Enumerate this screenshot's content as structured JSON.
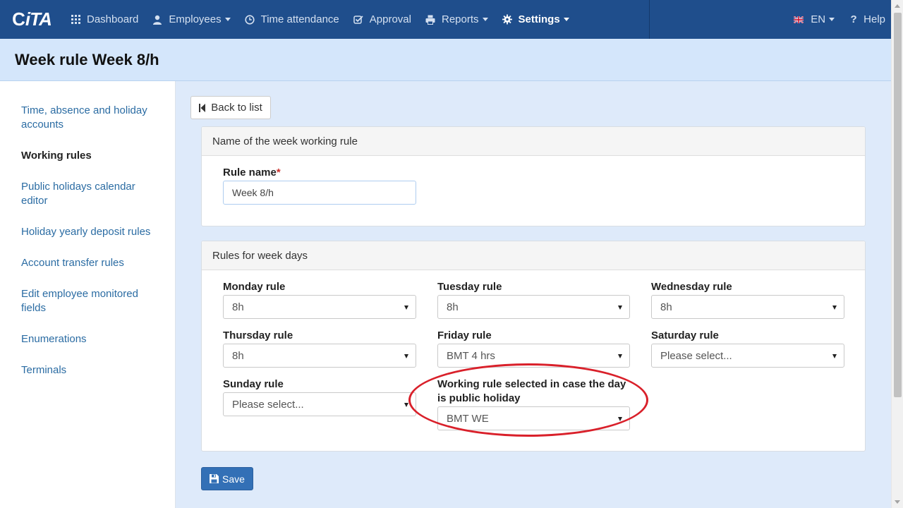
{
  "brand": {
    "name": "iTA"
  },
  "nav": {
    "items": [
      {
        "label": "Dashboard",
        "icon": "grid-icon"
      },
      {
        "label": "Employees",
        "icon": "user-icon",
        "dropdown": true
      },
      {
        "label": "Time attendance",
        "icon": "clock-icon"
      },
      {
        "label": "Approval",
        "icon": "check-square-icon"
      },
      {
        "label": "Reports",
        "icon": "printer-icon",
        "dropdown": true
      },
      {
        "label": "Settings",
        "icon": "gear-icon",
        "dropdown": true,
        "active": true
      }
    ],
    "language": "EN",
    "help": "Help"
  },
  "page": {
    "title": "Week rule Week 8/h"
  },
  "sidebar": {
    "items": [
      {
        "label": "Time, absence and holiday accounts"
      },
      {
        "label": "Working rules",
        "active": true
      },
      {
        "label": "Public holidays calendar editor"
      },
      {
        "label": "Holiday yearly deposit rules"
      },
      {
        "label": "Account transfer rules"
      },
      {
        "label": "Edit employee monitored fields"
      },
      {
        "label": "Enumerations"
      },
      {
        "label": "Terminals"
      }
    ]
  },
  "actions": {
    "back": "Back to list",
    "save": "Save"
  },
  "name_panel": {
    "heading": "Name of the week working rule",
    "rule_name_label": "Rule name",
    "required_mark": "*",
    "rule_name_value": "Week 8/h"
  },
  "days_panel": {
    "heading": "Rules for week days",
    "monday": {
      "label": "Monday rule",
      "value": "8h"
    },
    "tuesday": {
      "label": "Tuesday rule",
      "value": "8h"
    },
    "wednesday": {
      "label": "Wednesday rule",
      "value": "8h"
    },
    "thursday": {
      "label": "Thursday rule",
      "value": "8h"
    },
    "friday": {
      "label": "Friday rule",
      "value": "BMT 4 hrs"
    },
    "saturday": {
      "label": "Saturday rule",
      "value": "Please select..."
    },
    "sunday": {
      "label": "Sunday rule",
      "value": "Please select..."
    },
    "holiday": {
      "label": "Working rule selected in case the day is public holiday",
      "value": "BMT WE"
    }
  },
  "colors": {
    "navbar": "#1f4e8c",
    "header": "#d4e6fb",
    "main": "#deeafa",
    "annotation": "#d9202a",
    "save": "#3370b6"
  }
}
